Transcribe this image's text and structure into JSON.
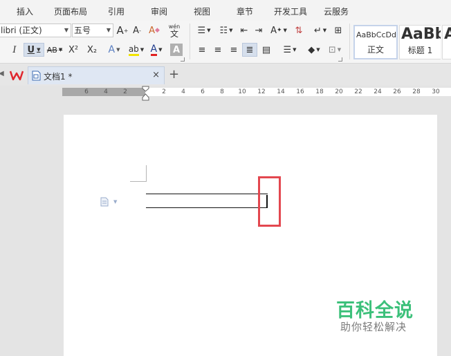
{
  "menu": {
    "tabs": [
      "插入",
      "页面布局",
      "引用",
      "审阅",
      "视图",
      "章节",
      "开发工具",
      "云服务"
    ]
  },
  "ribbon": {
    "font_name": "libri (正文)",
    "font_size": "五号",
    "change_case_label": "Aa",
    "pinyin_top": "wén",
    "pinyin_bottom": "文",
    "italic": "I",
    "underline": "U",
    "strike": "AB",
    "superscript": "X²",
    "subscript": "X₂",
    "font_color_label": "A",
    "styles": [
      {
        "sample": "AaBbCcDd",
        "name": "正文"
      },
      {
        "sample": "AaBb",
        "name": "标题 1"
      }
    ]
  },
  "tabbar": {
    "doc_title": "文档1 *",
    "close": "×",
    "add": "+"
  },
  "ruler": {
    "ticks": [
      "6",
      "4",
      "2",
      "2",
      "4",
      "6",
      "8",
      "10",
      "12",
      "14",
      "16",
      "18",
      "20",
      "22",
      "24",
      "26",
      "28",
      "30"
    ]
  },
  "watermark": {
    "title": "百科全说",
    "subtitle": "助你轻松解决"
  },
  "colors": {
    "highlight": "#e3474f",
    "watermark": "#3cc07a",
    "wps_logo": "#e0262e"
  }
}
